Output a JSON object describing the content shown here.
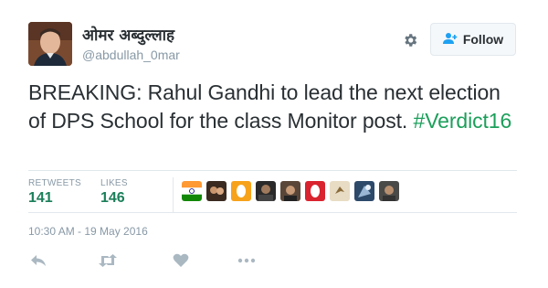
{
  "user": {
    "display_name": "ओमर अब्दुल्लाह",
    "username": "@abdullah_0mar"
  },
  "follow_label": "Follow",
  "tweet": {
    "text_part1": "BREAKING: Rahul Gandhi to lead the next election of DPS School for the class Monitor post.",
    "hashtag": "#Verdict16"
  },
  "stats": {
    "retweets_label": "RETWEETS",
    "retweets_value": "141",
    "likes_label": "LIKES",
    "likes_value": "146"
  },
  "timestamp": "10:30 AM - 19 May 2016",
  "colors": {
    "hashtag": "#1c9f5b",
    "stat_value": "#1b7f5a",
    "muted": "#8899a6",
    "border": "#e1e8ed"
  },
  "icons": {
    "settings": "gear-icon",
    "follow": "add-user-icon",
    "reply": "reply-icon",
    "retweet": "retweet-icon",
    "like": "heart-icon",
    "more": "more-icon"
  }
}
